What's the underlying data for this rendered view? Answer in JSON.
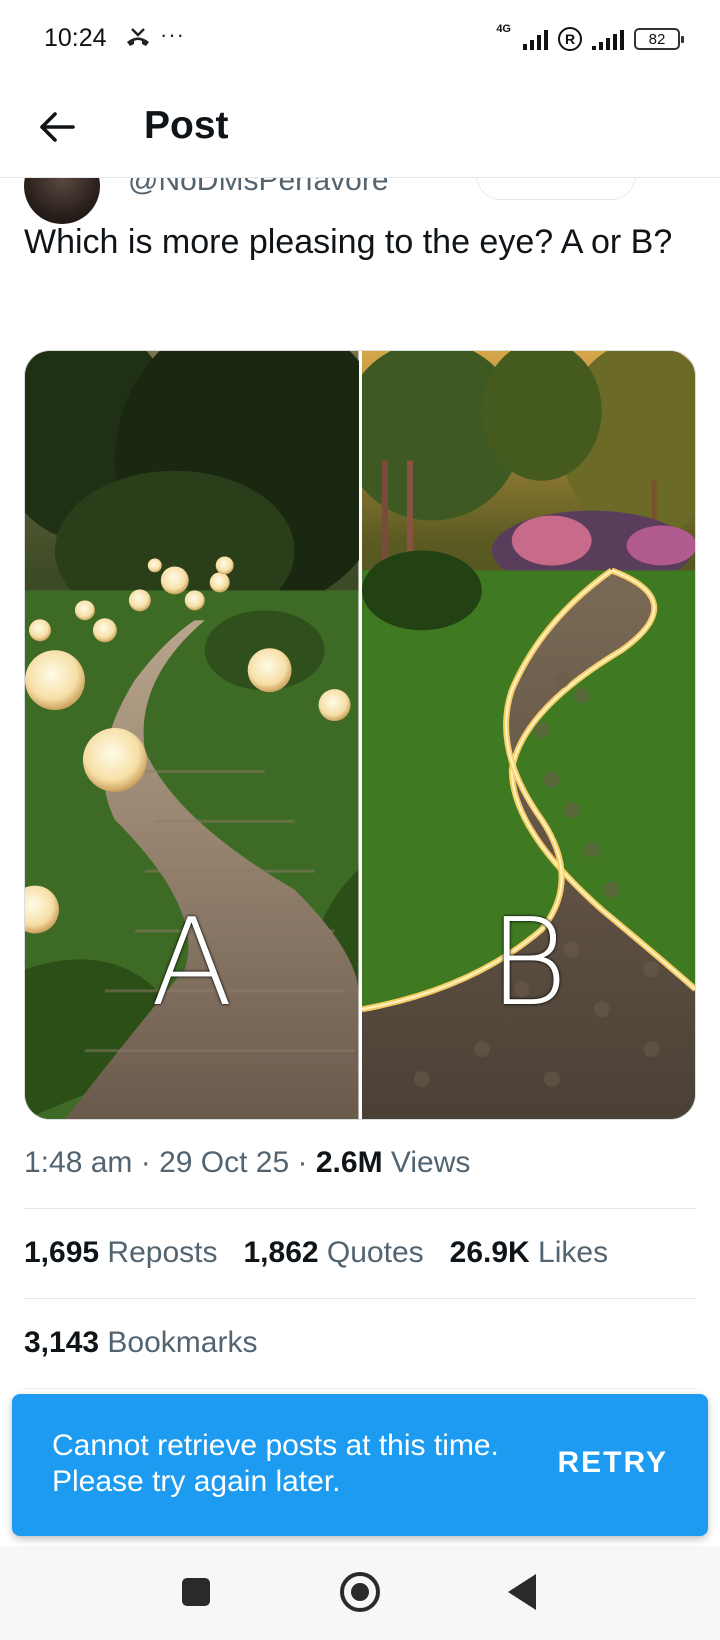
{
  "status_bar": {
    "time": "10:24",
    "dots": "···",
    "network_label": "4G",
    "roaming_symbol": "R",
    "battery": "82"
  },
  "header": {
    "title": "Post",
    "back_icon": "arrow-left-icon"
  },
  "post": {
    "author_handle": "@NoDMsPerfavore",
    "text": "Which is more pleasing to the eye? A or B?",
    "media": [
      {
        "letter": "A"
      },
      {
        "letter": "B"
      }
    ],
    "time": "1:48 am",
    "date": "29 Oct 25",
    "views_count": "2.6M",
    "views_label": "Views",
    "separator": "·"
  },
  "stats": {
    "reposts_count": "1,695",
    "reposts_label": "Reposts",
    "quotes_count": "1,862",
    "quotes_label": "Quotes",
    "likes_count": "26.9K",
    "likes_label": "Likes",
    "bookmarks_count": "3,143",
    "bookmarks_label": "Bookmarks"
  },
  "toast": {
    "message": "Cannot retrieve posts at this time. Please try again later.",
    "action": "RETRY"
  },
  "colors": {
    "accent": "#1d9bf0",
    "text_primary": "#0f1419",
    "text_secondary": "#536471"
  }
}
